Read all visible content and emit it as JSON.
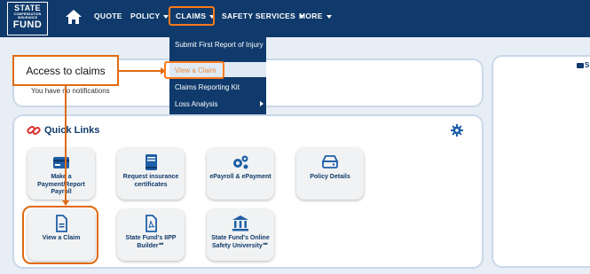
{
  "logo": {
    "line1": "STATE",
    "line2": "COMPENSATION",
    "line3": "INSURANCE",
    "line4": "FUND"
  },
  "nav": {
    "items": [
      {
        "label": "QUOTE",
        "caret": false
      },
      {
        "label": "POLICY",
        "caret": true
      },
      {
        "label": "CLAIMS",
        "caret": true
      },
      {
        "label": "SAFETY SERVICES",
        "caret": true
      },
      {
        "label": "MORE",
        "caret": true
      }
    ]
  },
  "dropdown": {
    "items": [
      {
        "label": "Submit First Report of Injury"
      },
      {
        "label": "View a Claim",
        "highlighted": true
      },
      {
        "label": "Claims Reporting Kit"
      },
      {
        "label": "Loss Analysis",
        "submenu": true
      }
    ]
  },
  "callout": {
    "text": "Access to claims"
  },
  "notifications": {
    "text": "You have no notifications"
  },
  "quick_links": {
    "title": "Quick Links",
    "tiles": [
      {
        "label": "Make a Payment/Report Payroll",
        "icon": "credit-card-icon"
      },
      {
        "label": "Request insurance certificates",
        "icon": "book-icon"
      },
      {
        "label": "ePayroll & ePayment",
        "icon": "gears-icon"
      },
      {
        "label": "Policy Details",
        "icon": "drive-icon"
      },
      {
        "label": "View a Claim",
        "icon": "document-icon"
      },
      {
        "label": "State Fund's IIPP Builder℠",
        "icon": "pdf-icon"
      },
      {
        "label": "State Fund's Online Safety University℠",
        "icon": "institution-icon"
      }
    ]
  },
  "right_panel": {
    "label_partial": "S"
  },
  "colors": {
    "navy": "#0f3a6b",
    "accent": "#e06a10",
    "page_bg": "#e8eef5"
  }
}
